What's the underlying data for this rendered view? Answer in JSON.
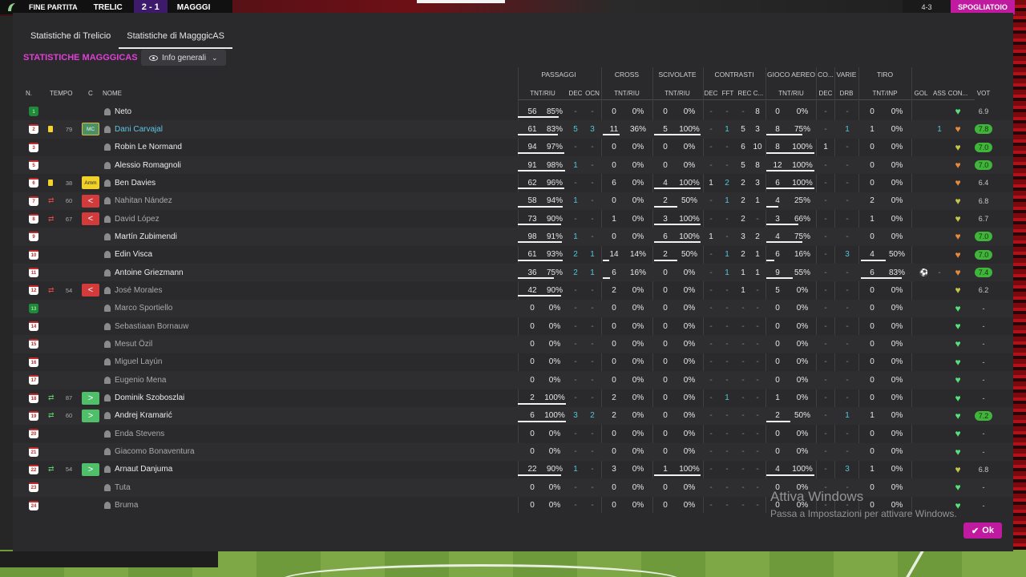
{
  "topbar": {
    "status": "FINE PARTITA",
    "home": "TRELIC",
    "score": "2 - 1",
    "away": "MAGGGI",
    "right_info": "4-3",
    "skip_label": "SPOGLIATOIO"
  },
  "tabs": [
    {
      "label": "Statistiche di Trelicio"
    },
    {
      "label": "Statistiche di MagggicAS"
    }
  ],
  "section_title": "STATISTICHE MAGGGICAS",
  "view_select": "Info generali",
  "groups": [
    "PASSAGGI",
    "CROSS",
    "SCIVOLATE",
    "CONTRASTI",
    "GIOCO AEREO",
    "CO...",
    "VARIE",
    "TIRO"
  ],
  "columns": {
    "n": "N.",
    "tempo": "TEMPO",
    "c": "C",
    "nome": "NOME",
    "pass_tnt": "TNT/RIU",
    "pass_dec": "DEC",
    "pass_ocn": "OCN",
    "cross_tnt": "TNT/RIU",
    "sciv_tnt": "TNT/RIU",
    "con_dec": "DEC",
    "con_fft": "FFT",
    "con_rec": "REC",
    "con_c": "C...",
    "aereo_tnt": "TNT/RIU",
    "co_dec": "DEC",
    "varie_drb": "DRB",
    "tiro_tnt": "TNT/INP",
    "gol": "GOL",
    "ass": "ASS",
    "con": "CON...",
    "vot": "VOT"
  },
  "players": [
    {
      "num": "1",
      "gk": true,
      "ev": "",
      "min": "",
      "tag": "",
      "name": "Neto",
      "dim": false,
      "hl": false,
      "pt": "56",
      "pp": "85%",
      "pf": 0.85,
      "pd": "-",
      "po": "-",
      "ct": "0",
      "cp": "0%",
      "cf": 0,
      "st": "0",
      "sp": "0%",
      "sf": 0,
      "kd": "-",
      "kf": "-",
      "kr": "-",
      "kc": "8",
      "at": "0",
      "ap": "0%",
      "af": 0,
      "cd": "-",
      "dr": "-",
      "tt": "0",
      "tp": "0%",
      "tf": 0,
      "gol": "",
      "ass": "",
      "heart": "g",
      "vot": "6.9",
      "vg": false
    },
    {
      "num": "2",
      "gk": false,
      "ev": "y",
      "min": "79",
      "tag": "MC",
      "name": "Dani Carvajal",
      "dim": false,
      "hl": true,
      "pt": "61",
      "pp": "83%",
      "pf": 0.83,
      "pd": "5",
      "po": "3",
      "ct": "11",
      "cp": "36%",
      "cf": 0.36,
      "st": "5",
      "sp": "100%",
      "sf": 1,
      "kd": "-",
      "kf": "1",
      "kr": "5",
      "kc": "3",
      "at": "8",
      "ap": "75%",
      "af": 0.75,
      "cd": "-",
      "dr": "1",
      "tt": "1",
      "tp": "0%",
      "tf": 0,
      "gol": "",
      "ass": "1",
      "heart": "o",
      "vot": "7.8",
      "vg": true
    },
    {
      "num": "3",
      "gk": false,
      "ev": "",
      "min": "",
      "tag": "",
      "name": "Robin Le Normand",
      "dim": false,
      "hl": false,
      "pt": "94",
      "pp": "97%",
      "pf": 0.97,
      "pd": "-",
      "po": "-",
      "ct": "0",
      "cp": "0%",
      "cf": 0,
      "st": "0",
      "sp": "0%",
      "sf": 0,
      "kd": "-",
      "kf": "-",
      "kr": "6",
      "kc": "10",
      "at": "8",
      "ap": "100%",
      "af": 1,
      "cd": "1",
      "dr": "-",
      "tt": "0",
      "tp": "0%",
      "tf": 0,
      "gol": "",
      "ass": "",
      "heart": "y",
      "vot": "7.0",
      "vg": true
    },
    {
      "num": "5",
      "gk": false,
      "ev": "",
      "min": "",
      "tag": "",
      "name": "Alessio Romagnoli",
      "dim": false,
      "hl": false,
      "pt": "91",
      "pp": "98%",
      "pf": 0.98,
      "pd": "1",
      "po": "-",
      "ct": "0",
      "cp": "0%",
      "cf": 0,
      "st": "0",
      "sp": "0%",
      "sf": 0,
      "kd": "-",
      "kf": "-",
      "kr": "5",
      "kc": "8",
      "at": "12",
      "ap": "100%",
      "af": 1,
      "cd": "-",
      "dr": "-",
      "tt": "0",
      "tp": "0%",
      "tf": 0,
      "gol": "",
      "ass": "",
      "heart": "o",
      "vot": "7.0",
      "vg": true
    },
    {
      "num": "6",
      "gk": false,
      "ev": "y",
      "min": "38",
      "tag": "Amm",
      "name": "Ben Davies",
      "dim": false,
      "hl": false,
      "pt": "62",
      "pp": "96%",
      "pf": 0.96,
      "pd": "-",
      "po": "-",
      "ct": "6",
      "cp": "0%",
      "cf": 0,
      "st": "4",
      "sp": "100%",
      "sf": 1,
      "kd": "1",
      "kf": "2",
      "kr": "2",
      "kc": "3",
      "at": "6",
      "ap": "100%",
      "af": 1,
      "cd": "-",
      "dr": "-",
      "tt": "0",
      "tp": "0%",
      "tf": 0,
      "gol": "",
      "ass": "",
      "heart": "o",
      "vot": "6.4",
      "vg": false
    },
    {
      "num": "7",
      "gk": false,
      "ev": "out",
      "min": "60",
      "tag": "<",
      "name": "Nahitan Nández",
      "dim": true,
      "hl": false,
      "pt": "58",
      "pp": "94%",
      "pf": 0.94,
      "pd": "1",
      "po": "-",
      "ct": "0",
      "cp": "0%",
      "cf": 0,
      "st": "2",
      "sp": "50%",
      "sf": 0.5,
      "kd": "-",
      "kf": "1",
      "kr": "2",
      "kc": "1",
      "at": "4",
      "ap": "25%",
      "af": 0.25,
      "cd": "-",
      "dr": "-",
      "tt": "2",
      "tp": "0%",
      "tf": 0,
      "gol": "",
      "ass": "",
      "heart": "y",
      "vot": "6.8",
      "vg": false
    },
    {
      "num": "8",
      "gk": false,
      "ev": "out",
      "min": "67",
      "tag": "<",
      "name": "David López",
      "dim": true,
      "hl": false,
      "pt": "73",
      "pp": "90%",
      "pf": 0.9,
      "pd": "-",
      "po": "-",
      "ct": "1",
      "cp": "0%",
      "cf": 0,
      "st": "3",
      "sp": "100%",
      "sf": 1,
      "kd": "-",
      "kf": "-",
      "kr": "2",
      "kc": "-",
      "at": "3",
      "ap": "66%",
      "af": 0.66,
      "cd": "-",
      "dr": "-",
      "tt": "1",
      "tp": "0%",
      "tf": 0,
      "gol": "",
      "ass": "",
      "heart": "y",
      "vot": "6.7",
      "vg": false
    },
    {
      "num": "9",
      "gk": false,
      "ev": "",
      "min": "",
      "tag": "",
      "name": "Martín Zubimendi",
      "dim": false,
      "hl": false,
      "pt": "98",
      "pp": "91%",
      "pf": 0.91,
      "pd": "1",
      "po": "-",
      "ct": "0",
      "cp": "0%",
      "cf": 0,
      "st": "6",
      "sp": "100%",
      "sf": 1,
      "kd": "1",
      "kf": "-",
      "kr": "3",
      "kc": "2",
      "at": "4",
      "ap": "75%",
      "af": 0.75,
      "cd": "-",
      "dr": "-",
      "tt": "0",
      "tp": "0%",
      "tf": 0,
      "gol": "",
      "ass": "",
      "heart": "o",
      "vot": "7.0",
      "vg": true
    },
    {
      "num": "10",
      "gk": false,
      "ev": "",
      "min": "",
      "tag": "",
      "name": "Edin Visca",
      "dim": false,
      "hl": false,
      "pt": "61",
      "pp": "93%",
      "pf": 0.93,
      "pd": "2",
      "po": "1",
      "ct": "14",
      "cp": "14%",
      "cf": 0.14,
      "st": "2",
      "sp": "50%",
      "sf": 0.5,
      "kd": "-",
      "kf": "1",
      "kr": "2",
      "kc": "1",
      "at": "6",
      "ap": "16%",
      "af": 0.16,
      "cd": "-",
      "dr": "3",
      "tt": "4",
      "tp": "50%",
      "tf": 0.5,
      "gol": "",
      "ass": "",
      "heart": "o",
      "vot": "7.0",
      "vg": true
    },
    {
      "num": "11",
      "gk": false,
      "ev": "",
      "min": "",
      "tag": "",
      "name": "Antoine Griezmann",
      "dim": false,
      "hl": false,
      "pt": "36",
      "pp": "75%",
      "pf": 0.75,
      "pd": "2",
      "po": "1",
      "ct": "6",
      "cp": "16%",
      "cf": 0.16,
      "st": "0",
      "sp": "0%",
      "sf": 0,
      "kd": "-",
      "kf": "1",
      "kr": "1",
      "kc": "1",
      "at": "9",
      "ap": "55%",
      "af": 0.55,
      "cd": "-",
      "dr": "-",
      "tt": "6",
      "tp": "83%",
      "tf": 0.83,
      "gol": "⚽",
      "ass": "-",
      "heart": "o",
      "vot": "7.4",
      "vg": true
    },
    {
      "num": "12",
      "gk": false,
      "ev": "out",
      "min": "54",
      "tag": "<",
      "name": "José Morales",
      "dim": true,
      "hl": false,
      "pt": "42",
      "pp": "90%",
      "pf": 0.9,
      "pd": "-",
      "po": "-",
      "ct": "2",
      "cp": "0%",
      "cf": 0,
      "st": "0",
      "sp": "0%",
      "sf": 0,
      "kd": "-",
      "kf": "-",
      "kr": "1",
      "kc": "-",
      "at": "5",
      "ap": "0%",
      "af": 0,
      "cd": "-",
      "dr": "-",
      "tt": "0",
      "tp": "0%",
      "tf": 0,
      "gol": "",
      "ass": "",
      "heart": "y",
      "vot": "6.2",
      "vg": false
    },
    {
      "num": "13",
      "gk": true,
      "ev": "",
      "min": "",
      "tag": "",
      "name": "Marco Sportiello",
      "dim": true,
      "hl": false,
      "pt": "0",
      "pp": "0%",
      "pf": 0,
      "pd": "-",
      "po": "-",
      "ct": "0",
      "cp": "0%",
      "cf": 0,
      "st": "0",
      "sp": "0%",
      "sf": 0,
      "kd": "-",
      "kf": "-",
      "kr": "-",
      "kc": "-",
      "at": "0",
      "ap": "0%",
      "af": 0,
      "cd": "-",
      "dr": "-",
      "tt": "0",
      "tp": "0%",
      "tf": 0,
      "gol": "",
      "ass": "",
      "heart": "g",
      "vot": "-",
      "vg": false
    },
    {
      "num": "14",
      "gk": false,
      "ev": "",
      "min": "",
      "tag": "",
      "name": "Sebastiaan Bornauw",
      "dim": true,
      "hl": false,
      "pt": "0",
      "pp": "0%",
      "pf": 0,
      "pd": "-",
      "po": "-",
      "ct": "0",
      "cp": "0%",
      "cf": 0,
      "st": "0",
      "sp": "0%",
      "sf": 0,
      "kd": "-",
      "kf": "-",
      "kr": "-",
      "kc": "-",
      "at": "0",
      "ap": "0%",
      "af": 0,
      "cd": "-",
      "dr": "-",
      "tt": "0",
      "tp": "0%",
      "tf": 0,
      "gol": "",
      "ass": "",
      "heart": "g",
      "vot": "-",
      "vg": false
    },
    {
      "num": "15",
      "gk": false,
      "ev": "",
      "min": "",
      "tag": "",
      "name": "Mesut Özil",
      "dim": true,
      "hl": false,
      "pt": "0",
      "pp": "0%",
      "pf": 0,
      "pd": "-",
      "po": "-",
      "ct": "0",
      "cp": "0%",
      "cf": 0,
      "st": "0",
      "sp": "0%",
      "sf": 0,
      "kd": "-",
      "kf": "-",
      "kr": "-",
      "kc": "-",
      "at": "0",
      "ap": "0%",
      "af": 0,
      "cd": "-",
      "dr": "-",
      "tt": "0",
      "tp": "0%",
      "tf": 0,
      "gol": "",
      "ass": "",
      "heart": "g",
      "vot": "-",
      "vg": false
    },
    {
      "num": "16",
      "gk": false,
      "ev": "",
      "min": "",
      "tag": "",
      "name": "Miguel Layún",
      "dim": true,
      "hl": false,
      "pt": "0",
      "pp": "0%",
      "pf": 0,
      "pd": "-",
      "po": "-",
      "ct": "0",
      "cp": "0%",
      "cf": 0,
      "st": "0",
      "sp": "0%",
      "sf": 0,
      "kd": "-",
      "kf": "-",
      "kr": "-",
      "kc": "-",
      "at": "0",
      "ap": "0%",
      "af": 0,
      "cd": "-",
      "dr": "-",
      "tt": "0",
      "tp": "0%",
      "tf": 0,
      "gol": "",
      "ass": "",
      "heart": "g",
      "vot": "-",
      "vg": false
    },
    {
      "num": "17",
      "gk": false,
      "ev": "",
      "min": "",
      "tag": "",
      "name": "Eugenio Mena",
      "dim": true,
      "hl": false,
      "pt": "0",
      "pp": "0%",
      "pf": 0,
      "pd": "-",
      "po": "-",
      "ct": "0",
      "cp": "0%",
      "cf": 0,
      "st": "0",
      "sp": "0%",
      "sf": 0,
      "kd": "-",
      "kf": "-",
      "kr": "-",
      "kc": "-",
      "at": "0",
      "ap": "0%",
      "af": 0,
      "cd": "-",
      "dr": "-",
      "tt": "0",
      "tp": "0%",
      "tf": 0,
      "gol": "",
      "ass": "",
      "heart": "g",
      "vot": "-",
      "vg": false
    },
    {
      "num": "18",
      "gk": false,
      "ev": "in",
      "min": "87",
      "tag": ">",
      "name": "Dominik Szoboszlai",
      "dim": false,
      "hl": false,
      "pt": "2",
      "pp": "100%",
      "pf": 1,
      "pd": "-",
      "po": "-",
      "ct": "2",
      "cp": "0%",
      "cf": 0,
      "st": "0",
      "sp": "0%",
      "sf": 0,
      "kd": "-",
      "kf": "1",
      "kr": "-",
      "kc": "-",
      "at": "1",
      "ap": "0%",
      "af": 0,
      "cd": "-",
      "dr": "-",
      "tt": "0",
      "tp": "0%",
      "tf": 0,
      "gol": "",
      "ass": "",
      "heart": "g",
      "vot": "-",
      "vg": false
    },
    {
      "num": "19",
      "gk": false,
      "ev": "in",
      "min": "60",
      "tag": ">",
      "name": "Andrej Kramarić",
      "dim": false,
      "hl": false,
      "pt": "6",
      "pp": "100%",
      "pf": 1,
      "pd": "3",
      "po": "2",
      "ct": "2",
      "cp": "0%",
      "cf": 0,
      "st": "0",
      "sp": "0%",
      "sf": 0,
      "kd": "-",
      "kf": "-",
      "kr": "-",
      "kc": "-",
      "at": "2",
      "ap": "50%",
      "af": 0.5,
      "cd": "-",
      "dr": "1",
      "tt": "1",
      "tp": "0%",
      "tf": 0,
      "gol": "",
      "ass": "",
      "heart": "g",
      "vot": "7.2",
      "vg": true
    },
    {
      "num": "20",
      "gk": false,
      "ev": "",
      "min": "",
      "tag": "",
      "name": "Enda Stevens",
      "dim": true,
      "hl": false,
      "pt": "0",
      "pp": "0%",
      "pf": 0,
      "pd": "-",
      "po": "-",
      "ct": "0",
      "cp": "0%",
      "cf": 0,
      "st": "0",
      "sp": "0%",
      "sf": 0,
      "kd": "-",
      "kf": "-",
      "kr": "-",
      "kc": "-",
      "at": "0",
      "ap": "0%",
      "af": 0,
      "cd": "-",
      "dr": "-",
      "tt": "0",
      "tp": "0%",
      "tf": 0,
      "gol": "",
      "ass": "",
      "heart": "g",
      "vot": "-",
      "vg": false
    },
    {
      "num": "21",
      "gk": false,
      "ev": "",
      "min": "",
      "tag": "",
      "name": "Giacomo Bonaventura",
      "dim": true,
      "hl": false,
      "pt": "0",
      "pp": "0%",
      "pf": 0,
      "pd": "-",
      "po": "-",
      "ct": "0",
      "cp": "0%",
      "cf": 0,
      "st": "0",
      "sp": "0%",
      "sf": 0,
      "kd": "-",
      "kf": "-",
      "kr": "-",
      "kc": "-",
      "at": "0",
      "ap": "0%",
      "af": 0,
      "cd": "-",
      "dr": "-",
      "tt": "0",
      "tp": "0%",
      "tf": 0,
      "gol": "",
      "ass": "",
      "heart": "g",
      "vot": "-",
      "vg": false
    },
    {
      "num": "22",
      "gk": false,
      "ev": "in",
      "min": "54",
      "tag": ">",
      "name": "Arnaut Danjuma",
      "dim": false,
      "hl": false,
      "pt": "22",
      "pp": "90%",
      "pf": 0.9,
      "pd": "1",
      "po": "-",
      "ct": "3",
      "cp": "0%",
      "cf": 0,
      "st": "1",
      "sp": "100%",
      "sf": 1,
      "kd": "-",
      "kf": "-",
      "kr": "-",
      "kc": "-",
      "at": "4",
      "ap": "100%",
      "af": 1,
      "cd": "-",
      "dr": "3",
      "tt": "1",
      "tp": "0%",
      "tf": 0,
      "gol": "",
      "ass": "",
      "heart": "y",
      "vot": "6.8",
      "vg": false
    },
    {
      "num": "23",
      "gk": false,
      "ev": "",
      "min": "",
      "tag": "",
      "name": "Tuta",
      "dim": true,
      "hl": false,
      "pt": "0",
      "pp": "0%",
      "pf": 0,
      "pd": "-",
      "po": "-",
      "ct": "0",
      "cp": "0%",
      "cf": 0,
      "st": "0",
      "sp": "0%",
      "sf": 0,
      "kd": "-",
      "kf": "-",
      "kr": "-",
      "kc": "-",
      "at": "0",
      "ap": "0%",
      "af": 0,
      "cd": "-",
      "dr": "-",
      "tt": "0",
      "tp": "0%",
      "tf": 0,
      "gol": "",
      "ass": "",
      "heart": "g",
      "vot": "-",
      "vg": false
    },
    {
      "num": "24",
      "gk": false,
      "ev": "",
      "min": "",
      "tag": "",
      "name": "Bruma",
      "dim": true,
      "hl": false,
      "pt": "0",
      "pp": "0%",
      "pf": 0,
      "pd": "-",
      "po": "-",
      "ct": "0",
      "cp": "0%",
      "cf": 0,
      "st": "0",
      "sp": "0%",
      "sf": 0,
      "kd": "-",
      "kf": "-",
      "kr": "-",
      "kc": "-",
      "at": "0",
      "ap": "0%",
      "af": 0,
      "cd": "-",
      "dr": "-",
      "tt": "0",
      "tp": "0%",
      "tf": 0,
      "gol": "",
      "ass": "",
      "heart": "g",
      "vot": "-",
      "vg": false
    }
  ],
  "ok_label": "Ok",
  "watermark": {
    "title": "Attiva Windows",
    "subtitle": "Passa a Impostazioni per attivare Windows."
  }
}
